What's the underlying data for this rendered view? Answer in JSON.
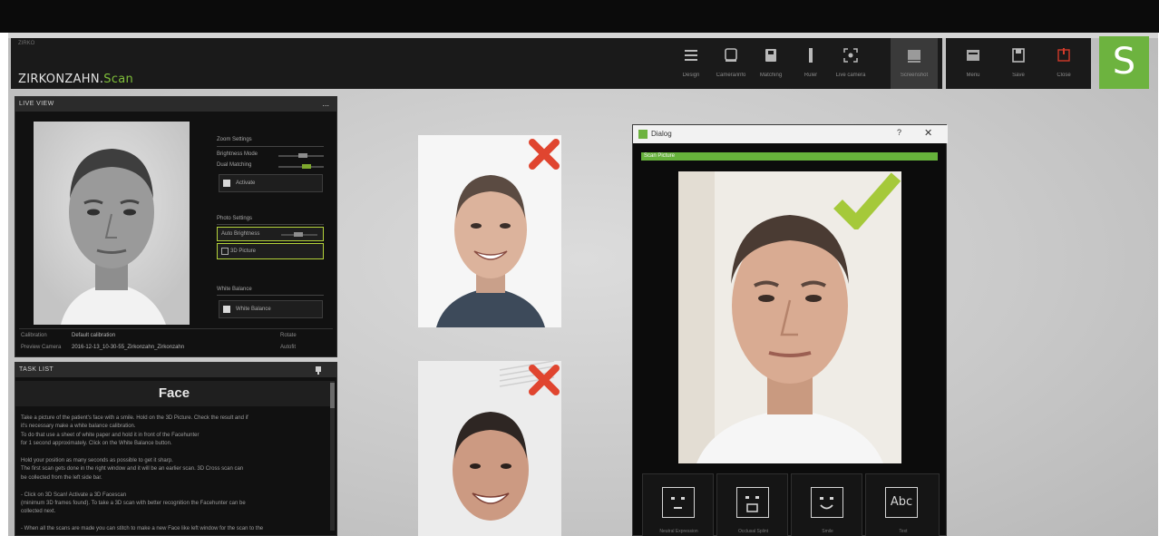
{
  "toolbar": {
    "app_menu": "ZIRKO",
    "brand_main": "ZIRKONZAHN.",
    "brand_accent": "Scan",
    "buttons": [
      {
        "label": "Design",
        "icon": "menu-lines-icon"
      },
      {
        "label": "Camera/info",
        "icon": "camera-icon"
      },
      {
        "label": "Matching",
        "icon": "matching-icon"
      },
      {
        "label": "Ruler",
        "icon": "ruler-icon"
      },
      {
        "label": "Live camera",
        "icon": "live-camera-icon"
      },
      {
        "label": "Screenshot",
        "icon": "screenshot-icon"
      }
    ],
    "file_buttons": [
      {
        "label": "Menu",
        "icon": "menu-icon"
      },
      {
        "label": "Save",
        "icon": "save-icon"
      },
      {
        "label": "Close",
        "icon": "power-icon"
      }
    ],
    "logo_letter": "S"
  },
  "live_view": {
    "title": "LIVE VIEW",
    "menu": "...",
    "zoom_settings_label": "Zoom Settings",
    "brightness_label": "Brightness Mode",
    "dual_matching_label": "Dual Matching",
    "activate_label": "Activate",
    "photo_settings_label": "Photo Settings",
    "auto_brightness_label": "Auto Brightness",
    "photo_3d_label": "3D Picture",
    "white_balance_section": "White Balance",
    "white_balance_button": "White Balance",
    "calibration_label": "Calibration",
    "calibration_value": "Default calibration",
    "preview_label": "Preview Camera",
    "preview_value": "2016-12-13_10-30-55_Zirkonzahn_Zirkonzahn",
    "rotate_label": "Rotate",
    "autofit_label": "Autofit"
  },
  "task_list": {
    "title": "TASK LIST",
    "heading": "Face",
    "lines": [
      "Take a picture of the patient's face with a smile. Hold on the 3D Picture. Check the result and if",
      "it's necessary make a white balance calibration.",
      "To do that use a sheet of white paper and hold it in front of the Facehunter",
      "for 1 second approximately. Click on the White Balance button.",
      "",
      "Hold your position as many seconds as possible to get it sharp.",
      "The first scan gets done in the right window and it will be an earlier scan. 3D Cross scan can",
      "be collected from the left side bar.",
      "",
      "- Click on 3D Scan! Activate a 3D Facescan",
      "  (minimum 3D frames found). To take a 3D scan with better recognition the Facehunter can be",
      "  collected next.",
      "",
      "- When all the scans are made you can stitch to make a new Face like left window for the scan to the"
    ]
  },
  "dialog": {
    "title": "Dialog",
    "help": "?",
    "close": "✕",
    "banner": "Scan Picture",
    "expressions": [
      {
        "label": "Neutral Expression"
      },
      {
        "label": "Occlusal Splint"
      },
      {
        "label": "Smile"
      },
      {
        "label": "Text",
        "text": "Abc"
      }
    ]
  }
}
